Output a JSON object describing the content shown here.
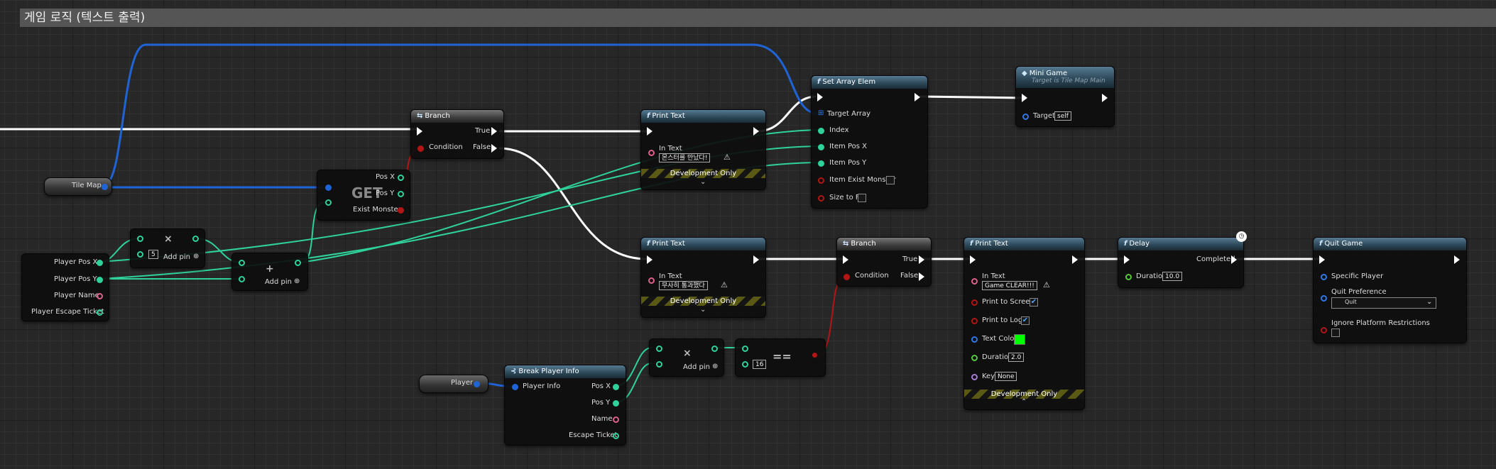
{
  "comment": {
    "title": "게임 로직 (텍스트 출력)"
  },
  "tile_map": {
    "label": "Tile Map"
  },
  "player_pos": {
    "x": "Player Pos X",
    "y": "Player Pos Y",
    "name": "Player Name",
    "ticket": "Player Escape Ticket"
  },
  "multiply": {
    "value": "5",
    "add_pin": "Add pin",
    "op": "×"
  },
  "add": {
    "add_pin": "Add pin",
    "op": "+"
  },
  "get": {
    "op": "GET",
    "pos_x": "Pos X",
    "pos_y": "Pos Y",
    "exist": "Exist Monster"
  },
  "branch1": {
    "title": "Branch",
    "condition": "Condition",
    "true_label": "True",
    "false_label": "False"
  },
  "print1": {
    "title": "Print Text",
    "in_text_label": "In Text",
    "text": "몬스터를 만났다!",
    "dev": "Development Only"
  },
  "set_array": {
    "title": "Set Array Elem",
    "target": "Target Array",
    "index": "Index",
    "pos_x": "Item Pos X",
    "pos_y": "Item Pos Y",
    "exist": "Item Exist Monster",
    "size": "Size to Fit"
  },
  "mini_game": {
    "title": "Mini Game",
    "subtitle": "Target is Tile Map Main",
    "target_label": "Target",
    "target_value": "self"
  },
  "print2": {
    "title": "Print Text",
    "in_text_label": "In Text",
    "text": "무사히 통과했다",
    "dev": "Development Only"
  },
  "branch2": {
    "title": "Branch",
    "condition": "Condition",
    "true_label": "True",
    "false_label": "False"
  },
  "print3": {
    "title": "Print Text",
    "in_text_label": "In Text",
    "text": "Game CLEAR!!!",
    "screen": "Print to Screen",
    "log": "Print to Log",
    "color": "Text Color",
    "duration_label": "Duration",
    "duration": "2.0",
    "key_label": "Key",
    "key": "None",
    "dev": "Development Only",
    "text_color": "#00ff00"
  },
  "delay": {
    "title": "Delay",
    "completed": "Completed",
    "duration_label": "Duration",
    "duration": "10.0"
  },
  "quit": {
    "title": "Quit Game",
    "player": "Specific Player",
    "pref_label": "Quit Preference",
    "pref_value": "Quit",
    "ignore": "Ignore Platform Restrictions"
  },
  "multiply2": {
    "add_pin": "Add pin",
    "op": "×"
  },
  "equal": {
    "value": "16",
    "op": "=="
  },
  "player": {
    "label": "Player"
  },
  "break_info": {
    "title": "Break Player Info",
    "player_info": "Player Info",
    "pos_x": "Pos X",
    "pos_y": "Pos Y",
    "name": "Name",
    "ticket": "Escape Ticket"
  },
  "colors": {
    "exec": "#ffffff",
    "int": "#2ed29a",
    "object": "#1f64d6",
    "bool": "#b31515",
    "string": "#e0608c"
  }
}
